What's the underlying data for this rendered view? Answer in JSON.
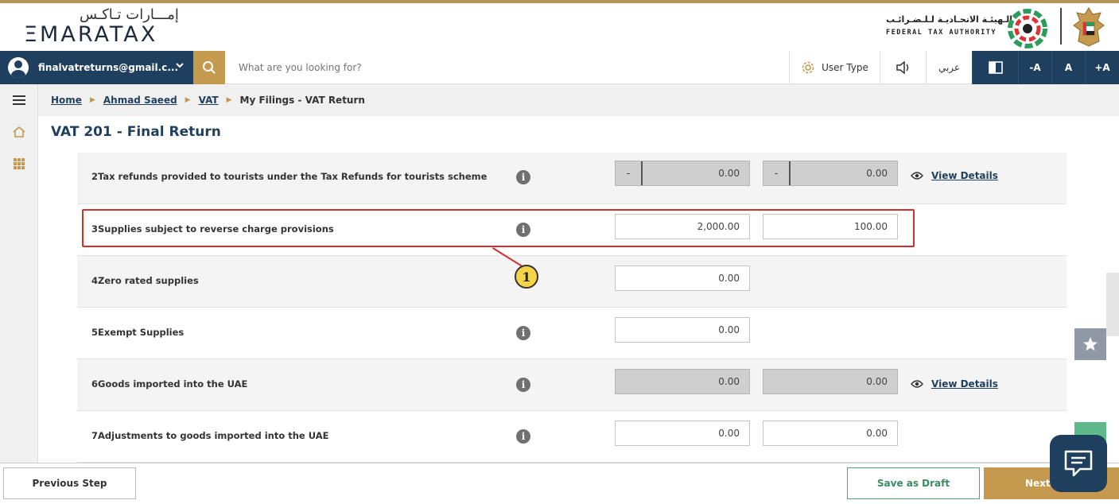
{
  "header": {
    "logo_arabic": "إمـــارات تـاكـس",
    "logo_english": "ΞMARATAX",
    "authority_arabic": "الـهيئـة الاتحـاديـة لـلـضـرائـب",
    "authority_english": "FEDERAL TAX AUTHORITY"
  },
  "navbar": {
    "user_email": "finalvatreturns@gmail.c...",
    "search_placeholder": "What are you looking for?",
    "user_type_label": "User Type",
    "language_label": "عربي",
    "font_decrease": "-A",
    "font_normal": "A",
    "font_increase": "+A"
  },
  "breadcrumb": {
    "home": "Home",
    "person": "Ahmad Saeed",
    "vat": "VAT",
    "current": "My Filings - VAT Return"
  },
  "page": {
    "title": "VAT 201 - Final Return"
  },
  "rows": [
    {
      "number": "2",
      "label": "Tax refunds provided to tourists under the Tax Refunds for tourists scheme",
      "amount": "0.00",
      "vat": "0.00",
      "amount_prefix": "-",
      "vat_prefix": "-",
      "view_details": "View Details"
    },
    {
      "number": "3",
      "label": "Supplies subject to reverse charge provisions",
      "amount": "2,000.00",
      "vat": "100.00"
    },
    {
      "number": "4",
      "label": "Zero rated supplies",
      "amount": "0.00"
    },
    {
      "number": "5",
      "label": "Exempt Supplies",
      "amount": "0.00"
    },
    {
      "number": "6",
      "label": "Goods imported into the UAE",
      "amount": "0.00",
      "vat": "0.00",
      "view_details": "View Details"
    },
    {
      "number": "7",
      "label": "Adjustments to goods imported into the UAE",
      "amount": "0.00",
      "vat": "0.00"
    }
  ],
  "callout": {
    "number": "1"
  },
  "footer": {
    "previous_label": "Previous Step",
    "draft_label": "Save as Draft",
    "next_label": "Next"
  },
  "colors": {
    "navy": "#1f3f5f",
    "gold": "#c59a4e",
    "highlight_red": "#d32f2f",
    "callout_yellow": "#f5d547"
  }
}
